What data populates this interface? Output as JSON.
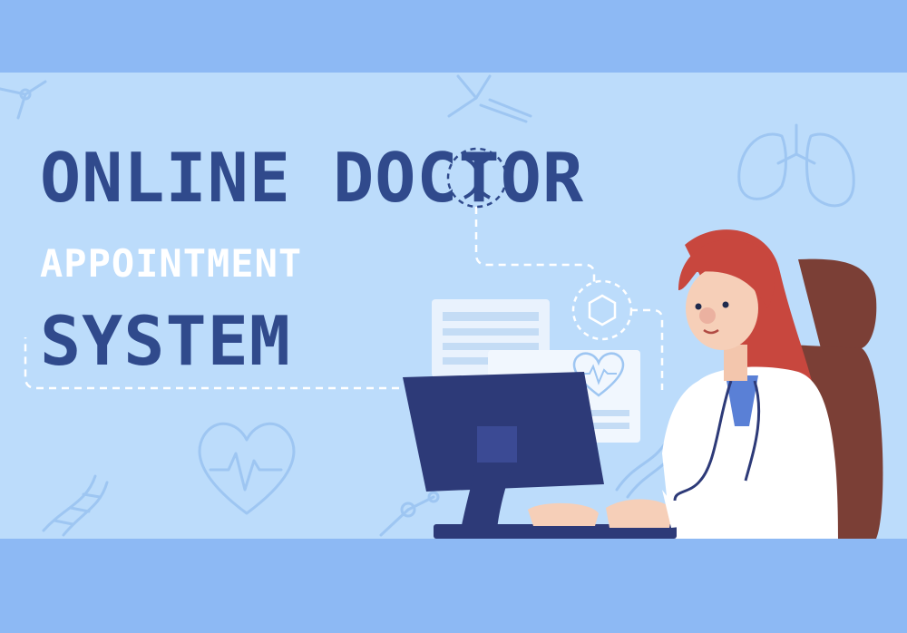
{
  "banner": {
    "title_line1": "ONLINE DOCTOR",
    "title_line2": "APPOINTMENT",
    "title_line3": "SYSTEM"
  },
  "icons": [
    "molecule-icon",
    "antibody-icon",
    "lungs-icon",
    "dna-icon",
    "heart-pulse-icon",
    "document-icon",
    "heart-monitor-icon"
  ],
  "colors": {
    "band": "#8db9f4",
    "panel": "#bcdcfb",
    "title_dark": "#304a8c",
    "title_light": "#ffffff",
    "outline": "#9ec6f2",
    "monitor": "#2d3a78",
    "hair": "#c8473e",
    "coat": "#ffffff",
    "chair": "#7b3f36"
  }
}
